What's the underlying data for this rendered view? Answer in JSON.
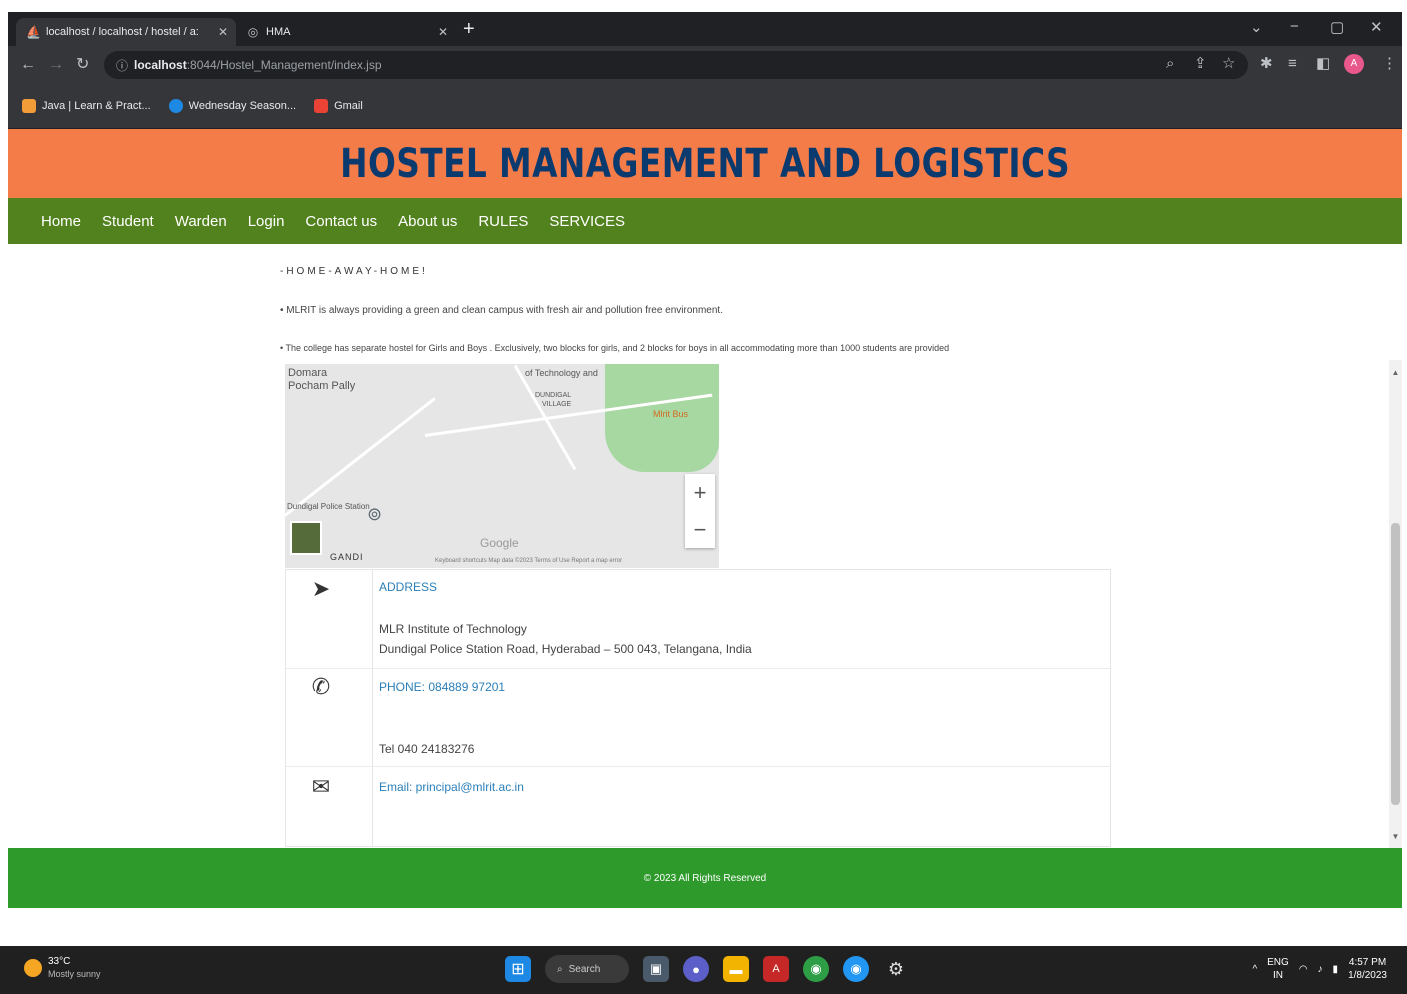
{
  "browser": {
    "tabs": [
      {
        "title": "localhost / localhost / hostel / a:",
        "active": true,
        "icon": "phpmyadmin-icon"
      },
      {
        "title": "HMA",
        "active": false,
        "icon": "globe-icon"
      }
    ],
    "url_host": "localhost",
    "url_rest": ":8044/Hostel_Management/index.jsp",
    "bookmarks": [
      {
        "label": "Java | Learn & Pract...",
        "color": "#f29d38"
      },
      {
        "label": "Wednesday Season...",
        "color": "#1e88e5"
      },
      {
        "label": "Gmail",
        "color": "#ea4335"
      }
    ],
    "profile_initial": "A"
  },
  "page": {
    "title": "HOSTEL MANAGEMENT AND LOGISTICS",
    "nav": [
      "Home",
      "Student",
      "Warden",
      "Login",
      "Contact us",
      "About us",
      "RULES",
      "SERVICES"
    ],
    "home_title": "-HOME-AWAY-HOME!",
    "para1": "• MLRIT is always providing a green and clean campus with fresh air and pollution free environment.",
    "para2": "• The college has separate hostel for Girls and Boys . Exclusively, two blocks for girls, and 2 blocks for boys in all accommodating more than 1000 students are provided",
    "map": {
      "labels": [
        "Domara",
        "Pocham Pally",
        "of Technology and",
        "DUNDIGAL",
        "VILLAGE",
        "Mlrit Bus",
        "Dundigal Police Station",
        "GANDI",
        "Google"
      ],
      "attribution": "Keyboard shortcuts   Map data ©2023   Terms of Use   Report a map error",
      "zoom_in": "+",
      "zoom_out": "−"
    },
    "contact": {
      "address_label": "ADDRESS",
      "address_line1": "MLR Institute of Technology",
      "address_line2": "Dundigal Police Station Road, Hyderabad – 500 043, Telangana, India",
      "phone_label": "PHONE: 084889 97201",
      "tel": "Tel 040 24183276",
      "email_label": "Email: principal@mlrit.ac.in"
    },
    "footer": "© 2023 All Rights Reserved"
  },
  "taskbar": {
    "temp": "33°C",
    "weather": "Mostly sunny",
    "search": "Search",
    "lang": "ENG",
    "region": "IN",
    "time": "4:57 PM",
    "date": "1/8/2023"
  },
  "colors": {
    "banner": "#f47c48",
    "title": "#0b3a6e",
    "navbar": "#52821e",
    "footer": "#2f9a2c",
    "link": "#2b7fb8"
  }
}
